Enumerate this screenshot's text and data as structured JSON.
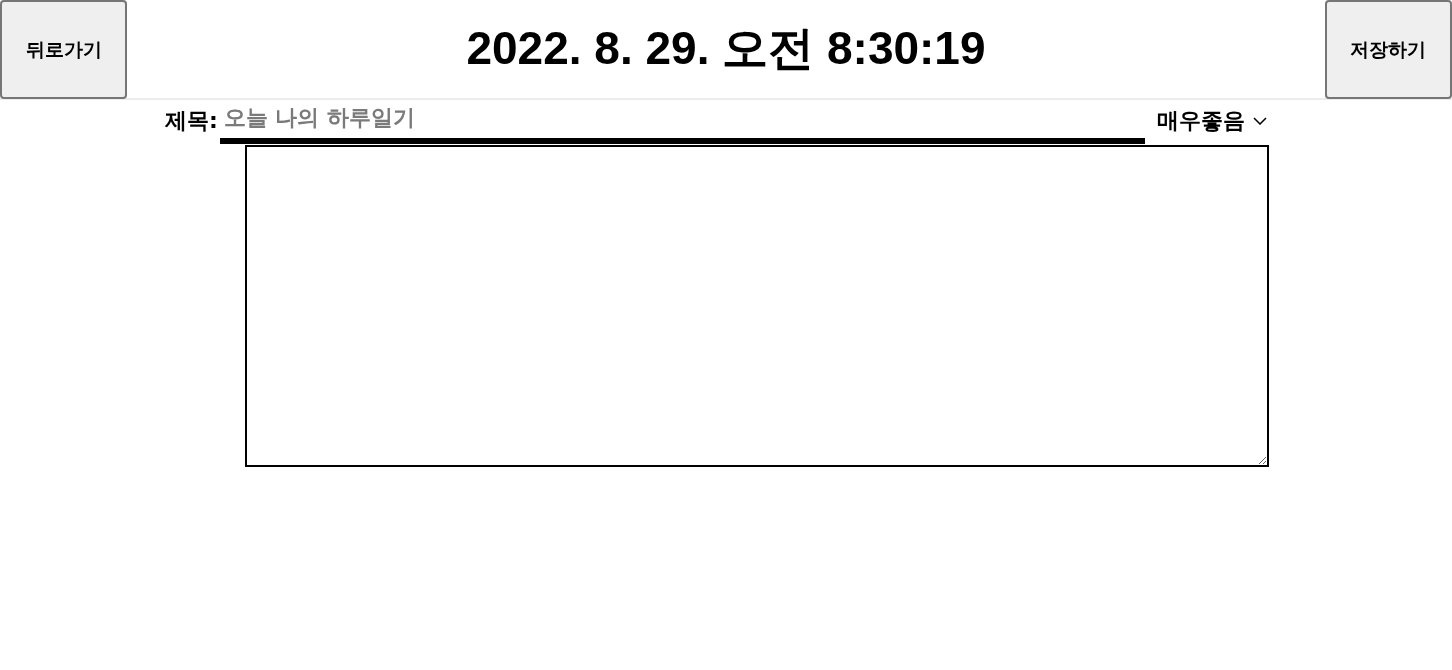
{
  "header": {
    "back_button": "뒤로가기",
    "date": "2022. 8. 29. 오전 8:30:19",
    "save_button": "저장하기"
  },
  "editor": {
    "title_label": "제목:",
    "title_field": {
      "placeholder": "오늘 나의 하루일기"
    },
    "mood_select": {
      "value": "매우좋음"
    }
  }
}
